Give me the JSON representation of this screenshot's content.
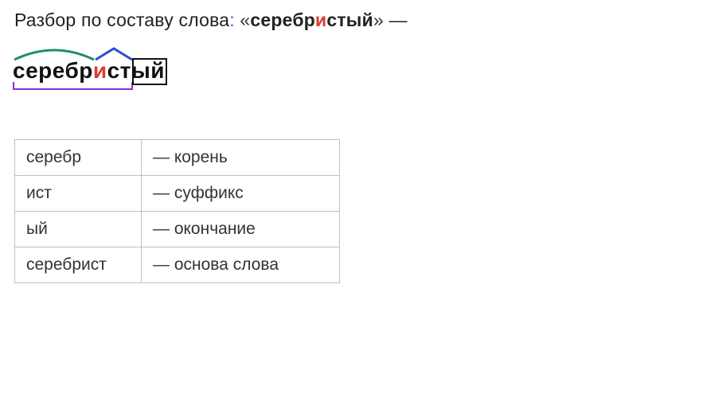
{
  "heading": {
    "prefix": "Разбор по составу слова",
    "colon": ":",
    "open_q": "«",
    "word_pre": "серебр",
    "word_stress": "и",
    "word_post": "стый",
    "close_q": "»",
    "dash": " —"
  },
  "diagram": {
    "root": "серебр",
    "suffix_stress": "и",
    "suffix_rest": "ст",
    "ending": "ый"
  },
  "table": {
    "rows": [
      {
        "morph": "серебр",
        "label": "— корень"
      },
      {
        "morph": "ист",
        "label": "— суффикс"
      },
      {
        "morph": "ый",
        "label": "— окончание"
      },
      {
        "morph": "серебрист",
        "label": "— основа слова"
      }
    ]
  }
}
